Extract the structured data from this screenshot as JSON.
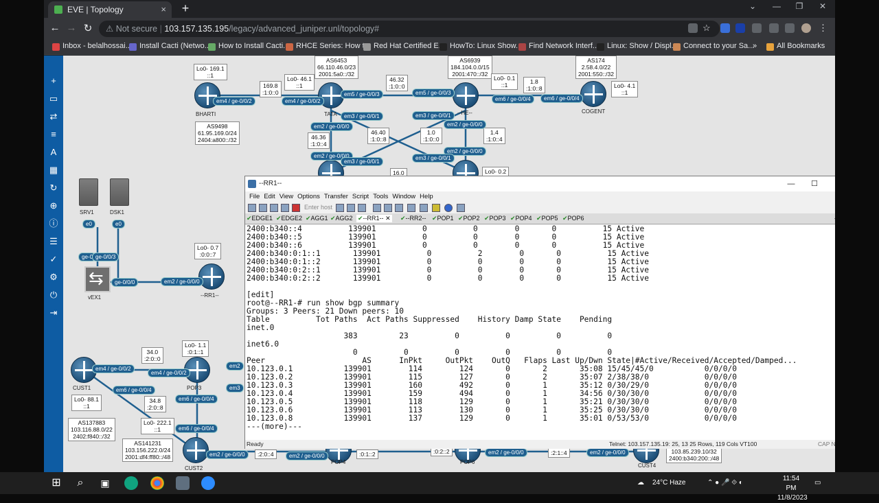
{
  "browser": {
    "tab_title": "EVE | Topology",
    "tab_close": "×",
    "new_tab": "+",
    "security": "Not secure",
    "url_host": "103.157.135.195",
    "url_path": "/legacy/advanced_juniper.unl/topology#",
    "bookmarks": [
      "Inbox - belalhossai...",
      "Install Cacti (Netwo...",
      "How to Install Cacti...",
      "RHCE Series: How t...",
      "Red Hat Certified E...",
      "HowTo: Linux Show...",
      "Find Network Interf...",
      "Linux: Show / Displ...",
      "Connect to your Sa..."
    ],
    "bookmarks_more": "»",
    "all_bookmarks": "All Bookmarks"
  },
  "topology": {
    "nodes": {
      "bharti": "BHARTI",
      "tata": "TATA",
      "he": "--HE--",
      "cogent": "COGENT",
      "srv1": "SRV1",
      "dsk1": "DSK1",
      "vex1": "vEX1",
      "rr1": "--RR1--",
      "cust1": "CUST1",
      "pop3": "POP3",
      "cust2": "CUST2",
      "pop4": "POP4",
      "pop6": "POP6",
      "cust4": "CUST4"
    },
    "boxes": {
      "bharti_lo": "Lo0- 169.1\n::1",
      "bharti_as": "AS9498\n61.95.169.0/24\n2404:a800::/32",
      "l1698": "169.8\n:1:0::0",
      "tata_lo": "Lo0- 46.1\n::1",
      "tata_as": "AS6453\n66.110.46.0/23\n2001:5a0::/32",
      "l4632": "46.32\n:1:0::0",
      "he_as": "AS6939\n184.104.0.0/15\n2001:470::/32",
      "he_lo": "Lo0- 0.1\n::1",
      "l18": "1.8\n:1:0::8",
      "cogent_as": "AS174\n2.58.4.0/22\n2001:550::/32",
      "cogent_lo": "Lo0- 4.1\n::1",
      "l4640": "46.40\n:1:0::8",
      "l4636": "46.36\n:1:0::4",
      "l10": "1.0\n:1:0::0",
      "l14": "1.4\n:1:0::4",
      "l160": "16.0",
      "lo02": "Lo0- 0.2",
      "rr1_lo": "Lo0- 0.7\n:0:0::7",
      "l340": "34.0\n:2:0::0",
      "pop3_lo": "Lo0- 1.1\n:0:1::1",
      "cust1_lo": "Lo0- 88.1\n::1",
      "cust1_as": "AS137883\n103.116.88.0/22\n2402:f840::/32",
      "l348": "34.8\n:2:0::8",
      "cust2_lo": "Lo0- 222.1\n::1",
      "cust2_as": "AS141231\n103.156.222.0/24\n2001:df4:ff80::/48",
      "l204": ":2:0::4",
      "l012": ":0:1::2",
      "l022": ":0:2::2",
      "l214": ":2:1::4",
      "cust4_as": "103.85.239.10/32\n2400:b340:200::/48"
    },
    "ports": {
      "p1": "em4 / ge-0/0/2",
      "p2": "em4 / ge-0/0/2",
      "p3": "em5 / ge-0/0/3",
      "p4": "em5 / ge-0/0/3",
      "p5": "em6 / ge-0/0/4",
      "p6": "em6 / ge-0/0/4",
      "p7": "em3 / ge-0/0/1",
      "p8": "em3 / ge-0/0/1",
      "p9": "em2 / ge-0/0/0",
      "p10": "em2 / ge-0/0/0",
      "p11": "em2 / ge-0/0/0",
      "p12": "em3 / ge-0/0/1",
      "p13": "em2 / ge-0/0/0",
      "p14": "em3 / ge-0/0/1",
      "p15": "e0",
      "p16": "e0",
      "p17": "ge-0",
      "p18": "ge-0/0/3",
      "p19": "ge-0/0/0",
      "p20": "em2 / ge-0/0/0",
      "p21": "em4 / ge-0/0/2",
      "p22": "em4 / ge-0/0/2",
      "p23": "em6 / ge-0/0/4",
      "p24": "em6 / ge-0/0/4",
      "p25": "em6 / ge-0/0/4",
      "p26": "em2 / ge-0/0/0",
      "p27": "em2 / ge-0/0/0",
      "p28": "em2 / ge-0/0/0",
      "p29": "em2 / ge-0/0/0",
      "p30": "em2",
      "p31": "em3"
    }
  },
  "securecrt": {
    "title": "--RR1--",
    "menu": [
      "File",
      "Edit",
      "View",
      "Options",
      "Transfer",
      "Script",
      "Tools",
      "Window",
      "Help"
    ],
    "enter_host": "Enter host",
    "tabs": [
      "EDGE1",
      "EDGE2",
      "AGG1",
      "AGG2",
      "--RR1--",
      "--RR2--",
      "POP1",
      "POP2",
      "POP3",
      "POP4",
      "POP5",
      "POP6"
    ],
    "tab_close": "✕",
    "lines": [
      "2400:b340::4          139901          0          0        0       0          15 Active",
      "2400:b340::5          139901          0          0        0       0          15 Active",
      "2400:b340::6          139901          0          0        0       0          15 Active",
      "2400:b340:0:1::1       139901          0          2        0       0          15 Active",
      "2400:b340:0:1::2       139901          0          0        0       0          15 Active",
      "2400:b340:0:2::1       139901          0          0        0       0          15 Active",
      "2400:b340:0:2::2       139901          0          0        0       0          15 Active",
      "",
      "[edit]",
      "root@--RR1-# run show bgp summary",
      "Groups: 3 Peers: 21 Down peers: 10",
      "Table          Tot Paths  Act Paths Suppressed    History Damp State    Pending",
      "inet.0",
      "                     383         23          0          0          0          0",
      "inet6.0",
      "                       0          0          0          0          0          0",
      "Peer                     AS      InPkt     OutPkt    OutQ   Flaps Last Up/Dwn State|#Active/Received/Accepted/Damped...",
      "10.123.0.1           139901        114        124       0       2       35:08 15/45/45/0           0/0/0/0",
      "10.123.0.2           139901        115        127       0       2       35:07 2/38/38/0            0/0/0/0",
      "10.123.0.3           139901        160        492       0       1       35:12 0/30/29/0            0/0/0/0",
      "10.123.0.4           139901        159        494       0       1       34:56 0/30/30/0            0/0/0/0",
      "10.123.0.5           139901        118        129       0       1       35:21 0/30/30/0            0/0/0/0",
      "10.123.0.6           139901        113        130       0       1       35:25 0/30/30/0            0/0/0/0",
      "10.123.0.8           139901        137        129       0       1       35:01 0/53/53/0            0/0/0/0",
      "---(more)---"
    ],
    "status_ready": "Ready",
    "status_info": "Telnet: 103.157.135.19: 25,  13   25 Rows, 119 Cols  VT100",
    "status_caps": "CAP NUM"
  },
  "taskbar": {
    "weather": "24°C  Haze",
    "time": "11:54 PM",
    "date": "11/8/2023"
  }
}
